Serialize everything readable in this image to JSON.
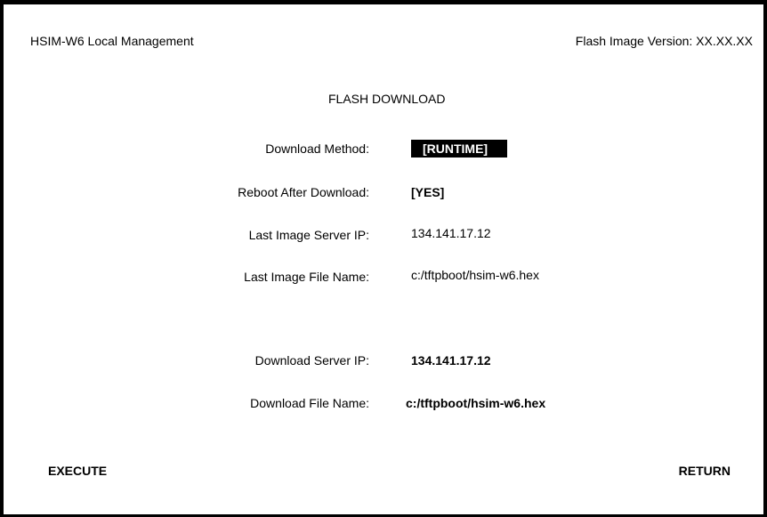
{
  "header": {
    "title": "HSIM-W6 Local Management",
    "version": "Flash Image Version: XX.XX.XX"
  },
  "page_title": "FLASH DOWNLOAD",
  "fields": {
    "download_method": {
      "label": "Download Method:",
      "value": "[RUNTIME]"
    },
    "reboot_after_download": {
      "label": "Reboot After Download:",
      "value": "[YES]"
    },
    "last_image_server_ip": {
      "label": "Last Image Server IP:",
      "value": "134.141.17.12"
    },
    "last_image_file_name": {
      "label": "Last Image File Name:",
      "value": "c:/tftpboot/hsim-w6.hex"
    },
    "download_server_ip": {
      "label": "Download Server IP:",
      "value": "134.141.17.12"
    },
    "download_file_name": {
      "label": "Download File Name:",
      "value": "c:/tftpboot/hsim-w6.hex"
    }
  },
  "commands": {
    "execute": "EXECUTE",
    "return": "RETURN"
  }
}
